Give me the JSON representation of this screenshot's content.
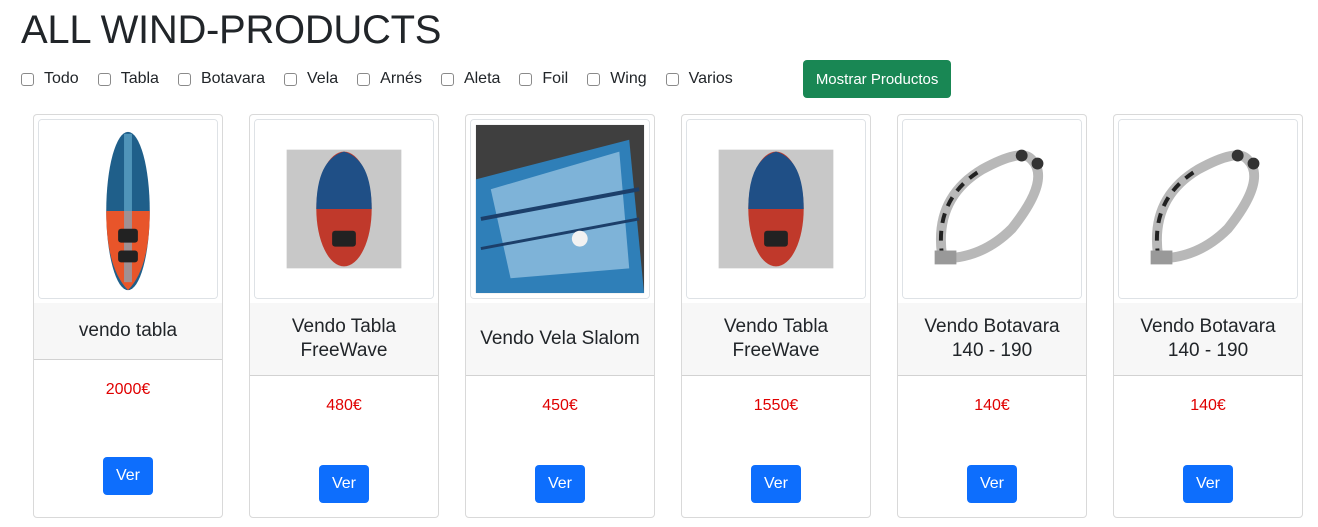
{
  "page_title": "ALL WIND-PRODUCTS",
  "filters": [
    {
      "label": "Todo"
    },
    {
      "label": "Tabla"
    },
    {
      "label": "Botavara"
    },
    {
      "label": "Vela"
    },
    {
      "label": "Arnés"
    },
    {
      "label": "Aleta"
    },
    {
      "label": "Foil"
    },
    {
      "label": "Wing"
    },
    {
      "label": "Varios"
    }
  ],
  "show_button": "Mostrar Productos",
  "colors": {
    "show_button": "#198754",
    "ver_button": "#0d6efd",
    "price": "#e00000"
  },
  "products": [
    {
      "name": "vendo tabla",
      "price": "2000€",
      "button": "Ver",
      "image": "windsurf-board-icon"
    },
    {
      "name": "Vendo Tabla FreeWave",
      "price": "480€",
      "button": "Ver",
      "image": "windsurf-board-icon"
    },
    {
      "name": "Vendo Vela Slalom",
      "price": "450€",
      "button": "Ver",
      "image": "sail-photo-icon"
    },
    {
      "name": "Vendo Tabla FreeWave",
      "price": "1550€",
      "button": "Ver",
      "image": "windsurf-board-icon"
    },
    {
      "name": "Vendo Botavara 140 - 190",
      "price": "140€",
      "button": "Ver",
      "image": "boom-icon"
    },
    {
      "name": "Vendo Botavara 140 - 190",
      "price": "140€",
      "button": "Ver",
      "image": "boom-icon"
    }
  ]
}
